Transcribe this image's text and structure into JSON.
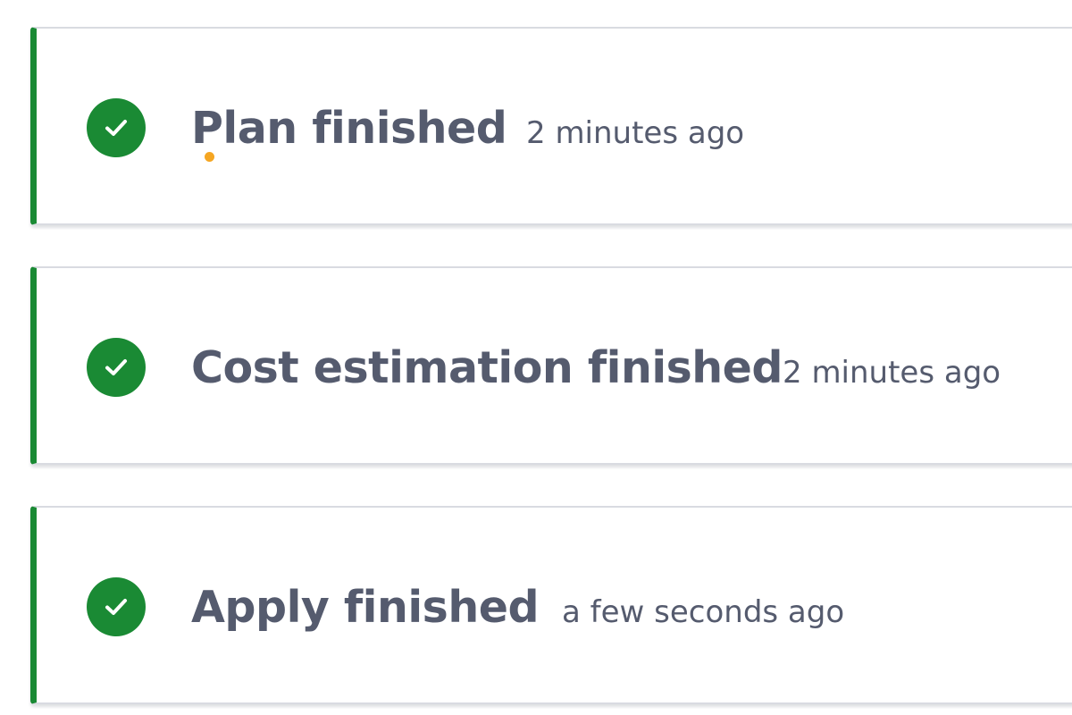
{
  "runs": [
    {
      "title": "Plan finished",
      "time": "2 minutes ago",
      "status": "success"
    },
    {
      "title": "Cost estimation finished",
      "time": "2 minutes ago",
      "status": "success"
    },
    {
      "title": "Apply finished",
      "time": "a few seconds ago",
      "status": "success"
    }
  ],
  "colors": {
    "success": "#1a8a34",
    "text": "#555b6e",
    "card_border": "#d9dbe1",
    "cursor_dot": "#f5a623"
  },
  "icons": {
    "status": "check-circle-icon"
  }
}
